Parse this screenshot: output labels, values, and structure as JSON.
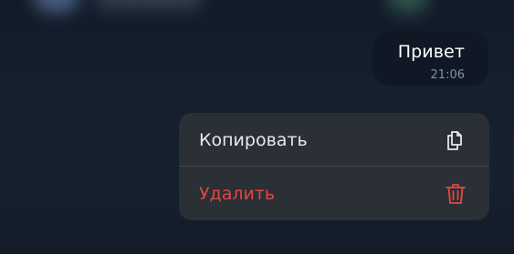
{
  "message": {
    "text": "Привет",
    "time": "21:06"
  },
  "context_menu": {
    "items": [
      {
        "label": "Копировать",
        "icon": "copy-icon",
        "color": "#e6e9ee"
      },
      {
        "label": "Удалить",
        "icon": "trash-icon",
        "color": "#e5463f"
      }
    ]
  },
  "colors": {
    "background": "#15202e",
    "bubble": "#0f1824",
    "menu": "#2b2f36",
    "destructive": "#e5463f",
    "timestamp": "#7d93ac"
  }
}
